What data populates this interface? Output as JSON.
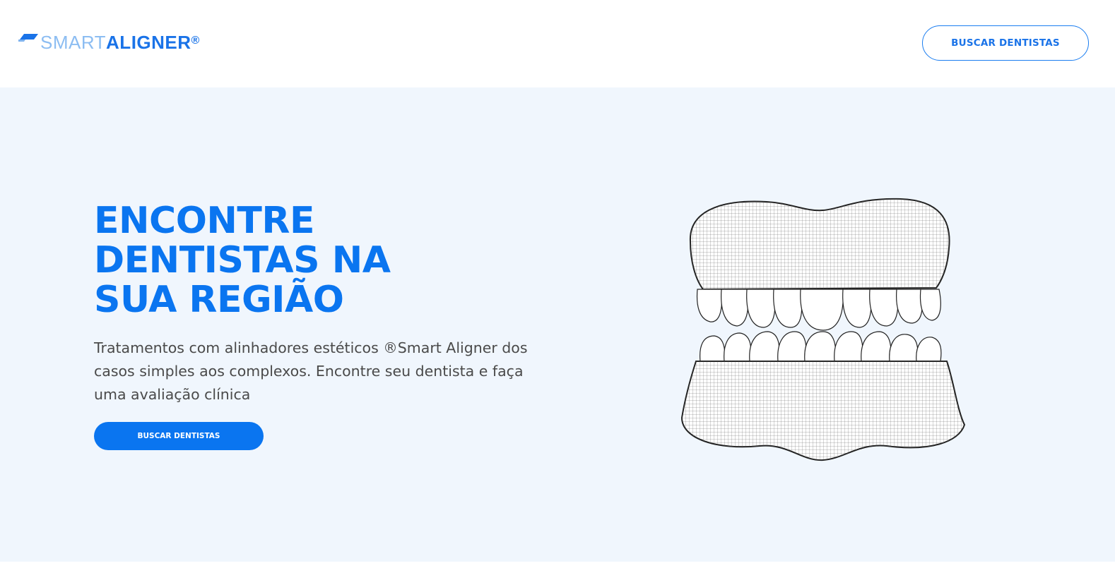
{
  "header": {
    "logo": {
      "light_text": "SMART",
      "bold_text": "ALIGNER",
      "registered_mark": "®",
      "mark_color": "#1a73e8"
    },
    "cta_label": "BUSCAR DENTISTAS"
  },
  "hero": {
    "title_lines": [
      "ENCONTRE",
      "DENTISTAS NA",
      "SUA REGIÃO"
    ],
    "description_lines": [
      "Tratamentos com alinhadores estéticos ®Smart Aligner dos",
      "casos simples aos complexos. Encontre seu dentista e faça",
      "uma avaliação clínica"
    ],
    "cta_label": "BUSCAR DENTISTAS",
    "illustration": "dental-arches-wireframe-icon"
  },
  "colors": {
    "brand_blue": "#0a75f0",
    "hero_background": "#f0f6fd",
    "text_gray": "#4a4a4a"
  }
}
